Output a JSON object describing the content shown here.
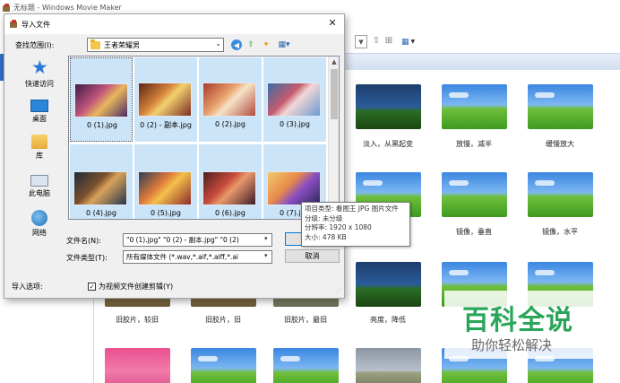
{
  "app": {
    "title": "无标题 - Windows Movie Maker"
  },
  "effects": [
    {
      "label": "",
      "style": "dark"
    },
    {
      "label": "",
      "style": "xp"
    },
    {
      "label": "",
      "style": "xp"
    },
    {
      "label": "淡入，从黑起变",
      "style": "xp"
    },
    {
      "label": "放慢，减半",
      "style": "ghost"
    },
    {
      "label": "缓慢放大",
      "style": "slow"
    },
    {
      "label": "",
      "style": "xp"
    },
    {
      "label": "",
      "style": "xp"
    },
    {
      "label": "",
      "style": "xp"
    },
    {
      "label": "",
      "style": "xp"
    },
    {
      "label": "镜像，垂直",
      "style": "xp"
    },
    {
      "label": "镜像，水平",
      "style": "xp"
    },
    {
      "label": "旧胶片，较旧",
      "style": "sepia"
    },
    {
      "label": "旧胶片，旧",
      "style": "sepia"
    },
    {
      "label": "旧胶片，最旧",
      "style": "gray"
    },
    {
      "label": "亮度，降低",
      "style": "dark"
    },
    {
      "label": "",
      "style": "xp"
    },
    {
      "label": "",
      "style": "xp"
    },
    {
      "label": "",
      "style": "pink"
    },
    {
      "label": "",
      "style": "xp"
    },
    {
      "label": "",
      "style": "xp"
    },
    {
      "label": "",
      "style": "gray"
    },
    {
      "label": "",
      "style": "xp"
    },
    {
      "label": "",
      "style": "xp"
    }
  ],
  "dialog": {
    "title": "导入文件",
    "lookin_label": "查找范围(I):",
    "lookin_value": "王者荣耀男",
    "places": [
      "快速访问",
      "桌面",
      "库",
      "此电脑",
      "网络"
    ],
    "files": [
      {
        "name": "0 (1).jpg",
        "selected": true
      },
      {
        "name": "0 (2) - 副本.jpg",
        "selected": true
      },
      {
        "name": "0 (2).jpg",
        "selected": true
      },
      {
        "name": "0 (3).jpg",
        "selected": true
      },
      {
        "name": "0 (4).jpg",
        "selected": true
      },
      {
        "name": "0 (5).jpg",
        "selected": true
      },
      {
        "name": "0 (6).jpg",
        "selected": true
      },
      {
        "name": "0 (7).jpg",
        "selected": true
      }
    ],
    "filename_label": "文件名(N):",
    "filename_value": "\"0 (1).jpg\" \"0 (2) - 副本.jpg\" \"0 (2)",
    "filetype_label": "文件类型(T):",
    "filetype_value": "所有媒体文件 (*.wav,*.aif,*.aiff,*.ai",
    "open_button": "打",
    "cancel_button": "取消",
    "import_options_label": "导入选项:",
    "create_clips_label": "为视频文件创建剪辑(Y)",
    "create_clips_checked": true
  },
  "tooltip": {
    "lines": [
      "项目类型: 看图王 JPG 图片文件",
      "分级: 未分级",
      "分辨率: 1920 x 1080",
      "大小: 478 KB"
    ]
  },
  "watermark": {
    "title": "百科全说",
    "subtitle": "助你轻松解决"
  },
  "colors": {
    "accent": "#2b7ad6",
    "selection": "#cce4f7",
    "watermark": "#2aa65a"
  }
}
